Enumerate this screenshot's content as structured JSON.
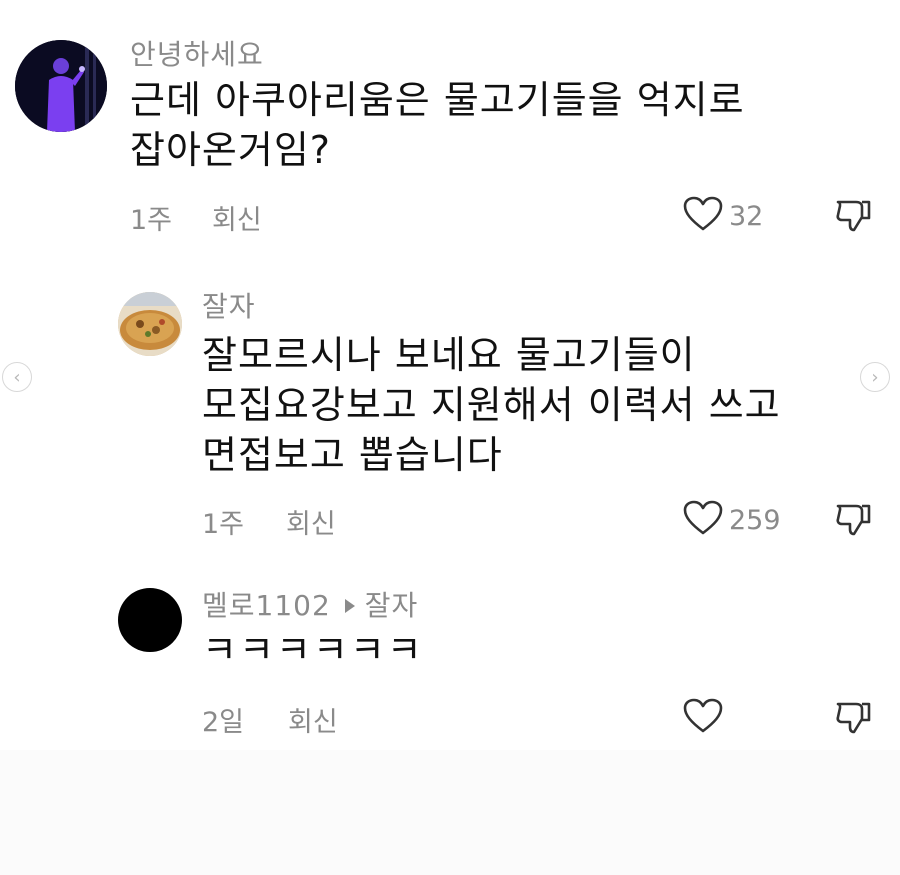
{
  "comments": [
    {
      "username": "안녕하세요",
      "text_lines": [
        "근데 아쿠아리움은 물고기들을 억지로",
        "잡아온거임?"
      ],
      "time": "1주",
      "reply_label": "회신",
      "likes": "32",
      "avatar_icon": "user-photo-avatar"
    },
    {
      "username": "잘자",
      "text_lines": [
        "잘모르시나 보네요 물고기들이",
        "모집요강보고 지원해서 이력서 쓰고",
        "면접보고 뽑습니다"
      ],
      "time": "1주",
      "reply_label": "회신",
      "likes": "259",
      "avatar_icon": "food-photo-avatar"
    },
    {
      "username": "멜로1102",
      "reply_to": "잘자",
      "text_lines": [
        "ㅋㅋㅋㅋㅋㅋ"
      ],
      "time": "2일",
      "reply_label": "회신",
      "likes": "",
      "avatar_icon": "black-avatar"
    }
  ],
  "icons": {
    "like": "heart-outline-icon",
    "dislike": "thumbs-down-icon",
    "prev": "chevron-left-icon",
    "next": "chevron-right-icon"
  }
}
